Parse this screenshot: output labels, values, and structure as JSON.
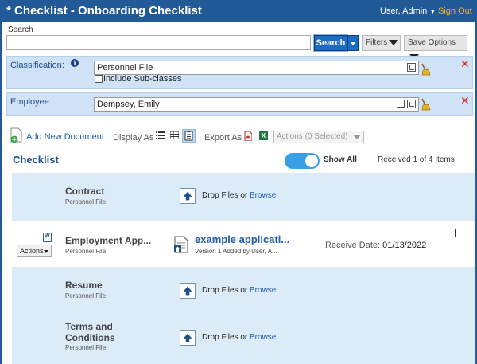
{
  "header": {
    "title": "* Checklist - Onboarding Checklist",
    "user": "User, Admin",
    "sign_out": "Sign Out"
  },
  "search": {
    "label": "Search",
    "value": "",
    "placeholder": "",
    "button": "Search",
    "filters": "Filters",
    "save_options": "Save Options"
  },
  "classification": {
    "label": "Classification:",
    "value": "Personnel File",
    "include_subclasses": "Include Sub-classes"
  },
  "employee": {
    "label": "Employee:",
    "value": "Dempsey, Emily"
  },
  "toolbar": {
    "add_new_document": "Add New Document",
    "display_as": "Display As",
    "export_as": "Export As",
    "actions_select": "Actions (0 Selected)",
    "xls_label": "X"
  },
  "checklist": {
    "title": "Checklist",
    "show_all": "Show All",
    "received": "Received 1 of 4 Items",
    "drop_files": "Drop Files or ",
    "browse": "Browse",
    "items": [
      {
        "title": "Contract",
        "subtitle": "Personnel File"
      },
      {
        "title": "Employment App...",
        "subtitle": "Personnel File",
        "actions": "Actions",
        "doc_title": "example applicati...",
        "doc_version": "Version 1 Added by User, A...",
        "receive_label": "Receive Date:",
        "receive_date": "01/13/2022"
      },
      {
        "title": "Resume",
        "subtitle": "Personnel File"
      },
      {
        "title": "Terms and Conditions",
        "subtitle": "Personnel File"
      }
    ]
  },
  "colors": {
    "header_bg": "#215a96",
    "accent_blue": "#1e6bc5",
    "panel_bg": "#cfe2f6",
    "row_blue": "#dcebf8",
    "sign_out": "#f0b030",
    "toggle_on": "#3aa0e6",
    "remove_red": "#e02020"
  },
  "icons": [
    "info-icon",
    "tree-browse-icon",
    "open-external-icon",
    "broom-clear-icon",
    "close-icon",
    "add-document-icon",
    "list-view-icon",
    "grid-view-icon",
    "table-view-icon",
    "pdf-icon",
    "excel-icon",
    "upload-icon",
    "word-doc-icon",
    "document-thumbnail-icon",
    "chevron-down-icon"
  ]
}
